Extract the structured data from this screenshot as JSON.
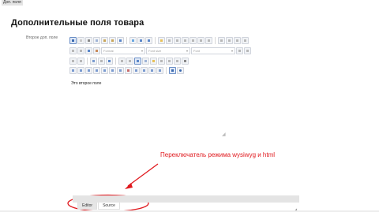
{
  "top_tag": "Доп. поля",
  "page_title": "Дополнительные поля товара",
  "field_label": "Второе доп. поле",
  "toolbar": {
    "combo_format": "Format",
    "combo_font_size": "Font size",
    "combo_font": "Font"
  },
  "editor": {
    "content": "Это второе поле"
  },
  "annotation": {
    "text": "Переключатель режима wysiwyg и html",
    "color": "#e0191e"
  },
  "mode_tabs": [
    {
      "label": "Editor"
    },
    {
      "label": "Source"
    }
  ]
}
